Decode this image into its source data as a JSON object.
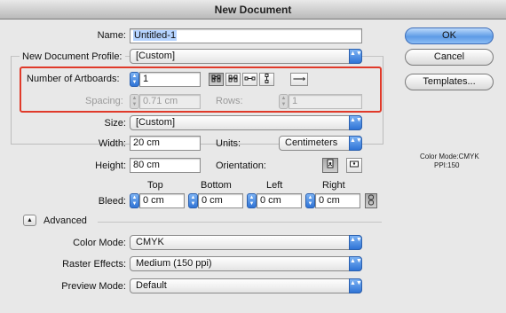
{
  "window": {
    "title": "New Document"
  },
  "name": {
    "label": "Name:",
    "value": "Untitled-1"
  },
  "profile": {
    "label": "New Document Profile:",
    "value": "[Custom]"
  },
  "artboards": {
    "count_label": "Number of Artboards:",
    "count_value": "1",
    "spacing_label": "Spacing:",
    "spacing_value": "0.71 cm",
    "rows_label": "Rows:",
    "rows_value": "1",
    "arrow_glyph": "⟶"
  },
  "size": {
    "label": "Size:",
    "value": "[Custom]"
  },
  "width": {
    "label": "Width:",
    "value": "20 cm"
  },
  "units": {
    "label": "Units:",
    "value": "Centimeters"
  },
  "height": {
    "label": "Height:",
    "value": "80 cm"
  },
  "orientation": {
    "label": "Orientation:"
  },
  "bleed": {
    "label": "Bleed:",
    "top_label": "Top",
    "top_value": "0 cm",
    "bottom_label": "Bottom",
    "bottom_value": "0 cm",
    "left_label": "Left",
    "left_value": "0 cm",
    "right_label": "Right",
    "right_value": "0 cm"
  },
  "advanced": {
    "label": "Advanced",
    "glyph": "▲"
  },
  "color_mode": {
    "label": "Color Mode:",
    "value": "CMYK"
  },
  "raster_effects": {
    "label": "Raster Effects:",
    "value": "Medium (150 ppi)"
  },
  "preview_mode": {
    "label": "Preview Mode:",
    "value": "Default"
  },
  "buttons": {
    "ok": "OK",
    "cancel": "Cancel",
    "templates": "Templates..."
  },
  "info": {
    "color_mode": "Color Mode:CMYK",
    "ppi": "PPI:150"
  },
  "icons": {
    "popup_arrows": "▲▼",
    "grid_by_row": "grid-by-row-icon",
    "grid_by_column": "grid-by-column-icon",
    "arrange_by_row": "arrange-by-row-icon",
    "arrange_by_column": "arrange-by-column-icon",
    "portrait": "portrait-icon",
    "landscape": "landscape-icon",
    "link": "link-icon"
  },
  "colors": {
    "highlight_box": "#e03a2a",
    "accent": "#3b7fe0"
  }
}
